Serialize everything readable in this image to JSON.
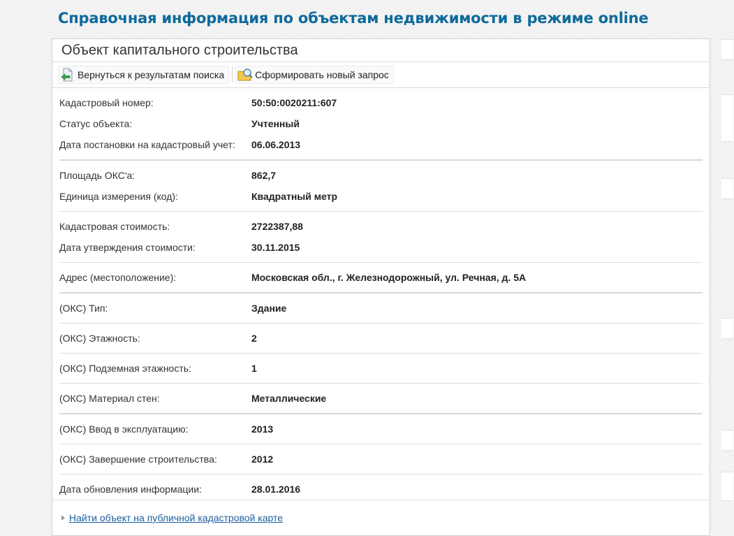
{
  "header": {
    "title": "Справочная информация по объектам недвижимости в режиме online"
  },
  "panel": {
    "title": "Объект капитального строительства"
  },
  "toolbar": {
    "back_label": "Вернуться к результатам поиска",
    "new_query_label": "Сформировать новый запрос"
  },
  "groups": [
    {
      "rows": [
        {
          "label": "Кадастровый номер:",
          "value": "50:50:0020211:607"
        },
        {
          "label": "Статус объекта:",
          "value": "Учтенный"
        },
        {
          "label": "Дата постановки на кадастровый учет:",
          "value": "06.06.2013"
        }
      ]
    },
    {
      "rows": [
        {
          "label": "Площадь ОКС'а:",
          "value": "862,7"
        },
        {
          "label": "Единица измерения (код):",
          "value": "Квадратный метр"
        }
      ]
    },
    {
      "rows": [
        {
          "label": "Кадастровая стоимость:",
          "value": "2722387,88"
        },
        {
          "label": "Дата утверждения стоимости:",
          "value": "30.11.2015"
        }
      ]
    },
    {
      "rows": [
        {
          "label": "Адрес (местоположение):",
          "value": "Московская обл., г. Железнодорожный, ул. Речная, д. 5А"
        }
      ]
    },
    {
      "rows": [
        {
          "label": "(ОКС) Тип:",
          "value": "Здание"
        }
      ]
    },
    {
      "rows": [
        {
          "label": "(ОКС) Этажность:",
          "value": "2"
        }
      ]
    },
    {
      "rows": [
        {
          "label": "(ОКС) Подземная этажность:",
          "value": "1"
        }
      ]
    },
    {
      "rows": [
        {
          "label": "(ОКС) Материал стен:",
          "value": "Металлические"
        }
      ]
    },
    {
      "rows": [
        {
          "label": "(ОКС) Ввод в эксплуатацию:",
          "value": "2013"
        }
      ]
    },
    {
      "rows": [
        {
          "label": "(ОКС) Завершение строительства:",
          "value": "2012"
        }
      ]
    },
    {
      "rows": [
        {
          "label": "Дата обновления информации:",
          "value": "28.01.2016"
        }
      ]
    }
  ],
  "footer": {
    "link_label": "Найти объект на публичной кадастровой карте"
  },
  "colors": {
    "title_blue": "#0e6a9c",
    "link_blue": "#1a5f9e"
  },
  "icons": {
    "back": "document-back-arrow-icon",
    "new_query": "folder-search-icon",
    "footer_bullet": "triangle-right-icon"
  }
}
